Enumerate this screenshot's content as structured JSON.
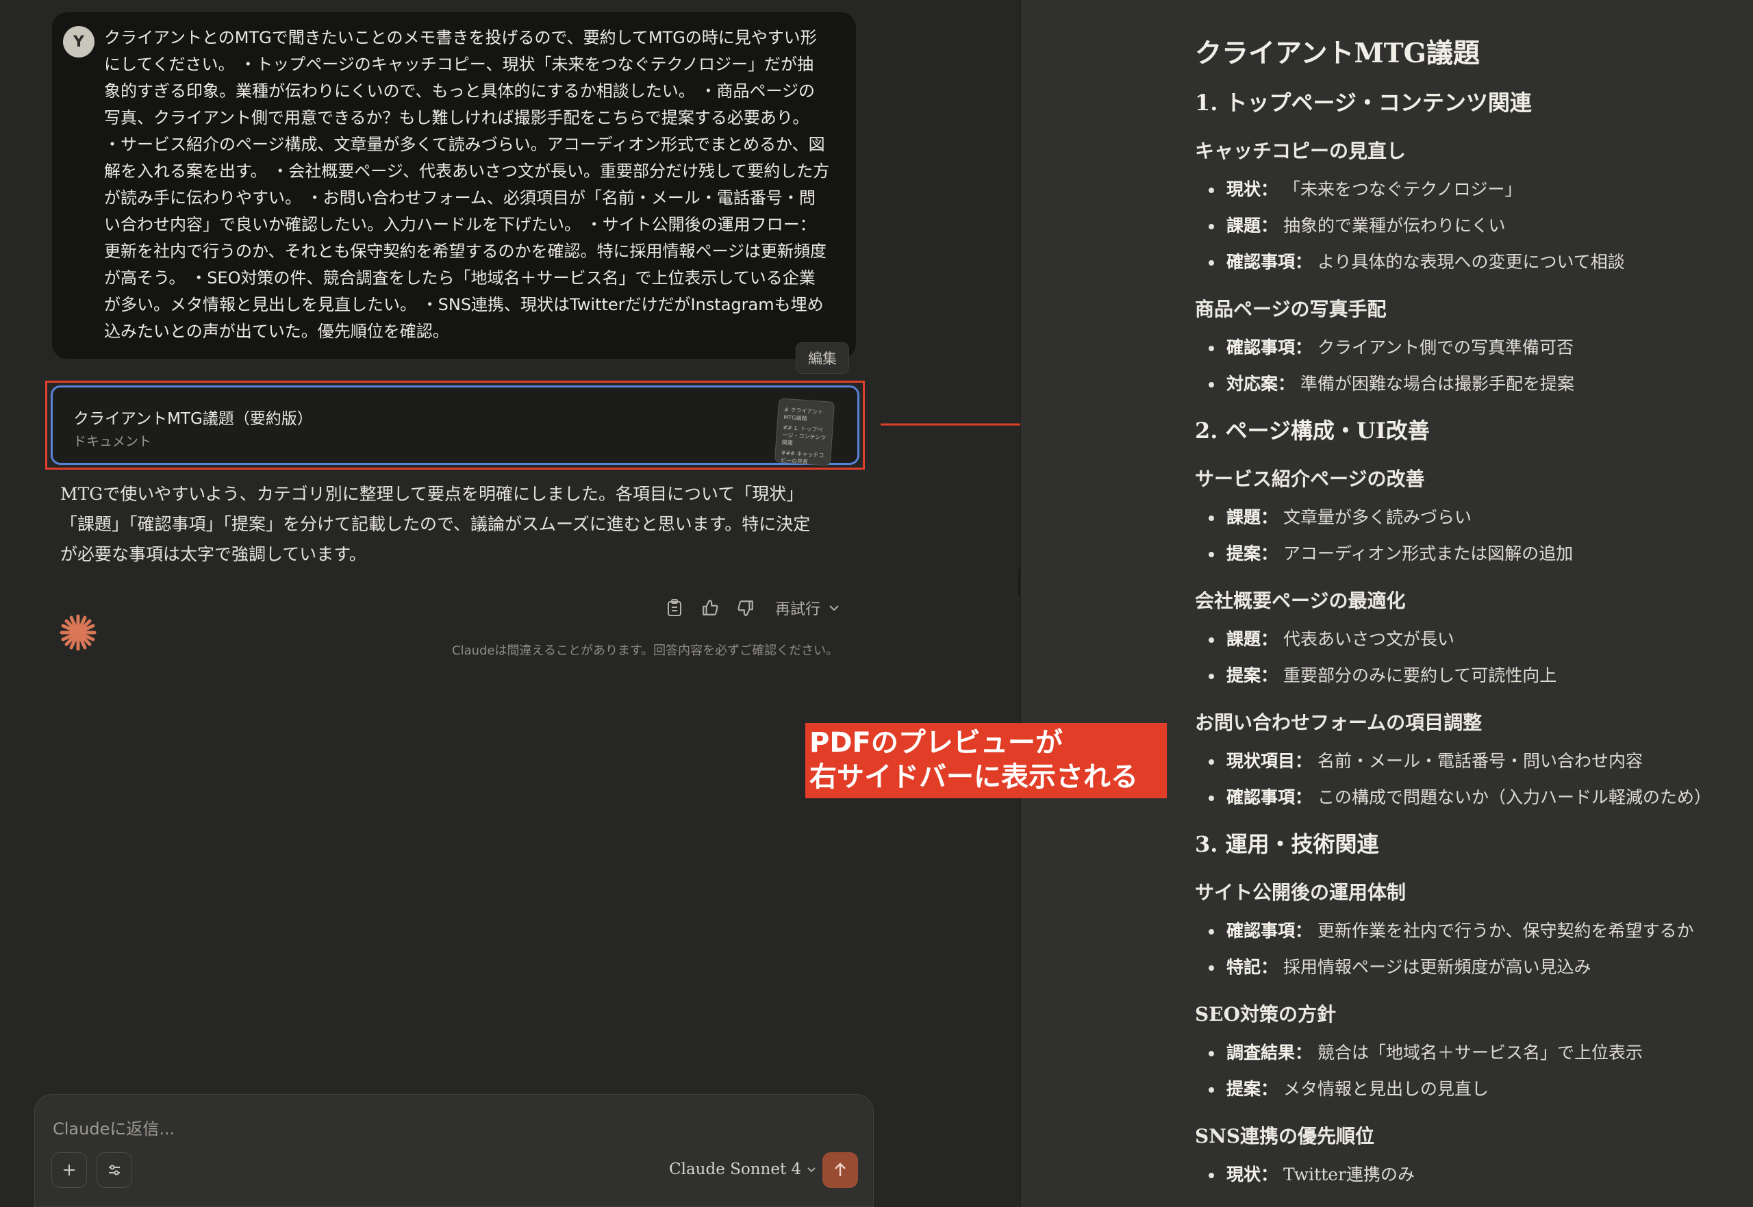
{
  "user": {
    "avatar_letter": "Y",
    "message": "クライアントとのMTGで聞きたいことのメモ書きを投げるので、要約してMTGの時に見やすい形にしてください。 ・トップページのキャッチコピー、現状「未来をつなぐテクノロジー」だが抽象的すぎる印象。業種が伝わりにくいので、もっと具体的にするか相談したい。 ・商品ページの写真、クライアント側で用意できるか？もし難しければ撮影手配をこちらで提案する必要あり。 ・サービス紹介のページ構成、文章量が多くて読みづらい。アコーディオン形式でまとめるか、図解を入れる案を出す。 ・会社概要ページ、代表あいさつ文が長い。重要部分だけ残して要約した方が読み手に伝わりやすい。 ・お問い合わせフォーム、必須項目が「名前・メール・電話番号・問い合わせ内容」で良いか確認したい。入力ハードルを下げたい。 ・サイト公開後の運用フロー：更新を社内で行うのか、それとも保守契約を希望するのかを確認。特に採用情報ページは更新頻度が高そう。 ・SEO対策の件、競合調査をしたら「地域名＋サービス名」で上位表示している企業が多い。メタ情報と見出しを見直したい。 ・SNS連携、現状はTwitterだけだがInstagramも埋め込みたいとの声が出ていた。優先順位を確認。",
    "edit_label": "編集"
  },
  "artifact": {
    "title": "クライアントMTG議題（要約版）",
    "type": "ドキュメント",
    "thumb_lines": [
      "# クライアントMTG議題",
      "## 1. トップページ・コンテンツ関連",
      "### キャッチコピーの見直"
    ]
  },
  "assistant": {
    "message": "MTGで使いやすいよう、カテゴリ別に整理して要点を明確にしました。各項目について「現状」「課題」「確認事項」「提案」を分けて記載したので、議論がスムーズに進むと思います。特に決定が必要な事項は太字で強調しています。",
    "retry_label": "再試行",
    "disclaimer": "Claudeは間違えることがあります。回答内容を必ずご確認ください。"
  },
  "composer": {
    "placeholder": "Claudeに返信...",
    "model": "Claude Sonnet 4"
  },
  "annotation": {
    "line1": "PDFのプレビューが",
    "line2": "右サイドバーに表示される"
  },
  "preview": {
    "title": "クライアントMTG議題",
    "sections": [
      {
        "heading": "1. トップページ・コンテンツ関連",
        "subsections": [
          {
            "heading": "キャッチコピーの見直し",
            "items": [
              {
                "label": "現状：",
                "text": "「未来をつなぐテクノロジー」"
              },
              {
                "label": "課題：",
                "text": "抽象的で業種が伝わりにくい"
              },
              {
                "label": "確認事項：",
                "text": "より具体的な表現への変更について相談"
              }
            ]
          },
          {
            "heading": "商品ページの写真手配",
            "items": [
              {
                "label": "確認事項：",
                "text": "クライアント側での写真準備可否"
              },
              {
                "label": "対応案：",
                "text": "準備が困難な場合は撮影手配を提案"
              }
            ]
          }
        ]
      },
      {
        "heading": "2. ページ構成・UI改善",
        "subsections": [
          {
            "heading": "サービス紹介ページの改善",
            "items": [
              {
                "label": "課題：",
                "text": "文章量が多く読みづらい"
              },
              {
                "label": "提案：",
                "text": "アコーディオン形式または図解の追加"
              }
            ]
          },
          {
            "heading": "会社概要ページの最適化",
            "items": [
              {
                "label": "課題：",
                "text": "代表あいさつ文が長い"
              },
              {
                "label": "提案：",
                "text": "重要部分のみに要約して可読性向上"
              }
            ]
          },
          {
            "heading": "お問い合わせフォームの項目調整",
            "items": [
              {
                "label": "現状項目：",
                "text": "名前・メール・電話番号・問い合わせ内容"
              },
              {
                "label": "確認事項：",
                "text": "この構成で問題ないか（入力ハードル軽減のため）"
              }
            ]
          }
        ]
      },
      {
        "heading": "3. 運用・技術関連",
        "subsections": [
          {
            "heading": "サイト公開後の運用体制",
            "items": [
              {
                "label": "確認事項：",
                "text": "更新作業を社内で行うか、保守契約を希望するか"
              },
              {
                "label": "特記：",
                "text": "採用情報ページは更新頻度が高い見込み"
              }
            ]
          },
          {
            "heading": "SEO対策の方針",
            "items": [
              {
                "label": "調査結果：",
                "text": "競合は「地域名＋サービス名」で上位表示"
              },
              {
                "label": "提案：",
                "text": "メタ情報と見出しの見直し"
              }
            ]
          },
          {
            "heading": "SNS連携の優先順位",
            "items": [
              {
                "label": "現状：",
                "text": "Twitter連携のみ"
              }
            ]
          }
        ]
      }
    ]
  }
}
